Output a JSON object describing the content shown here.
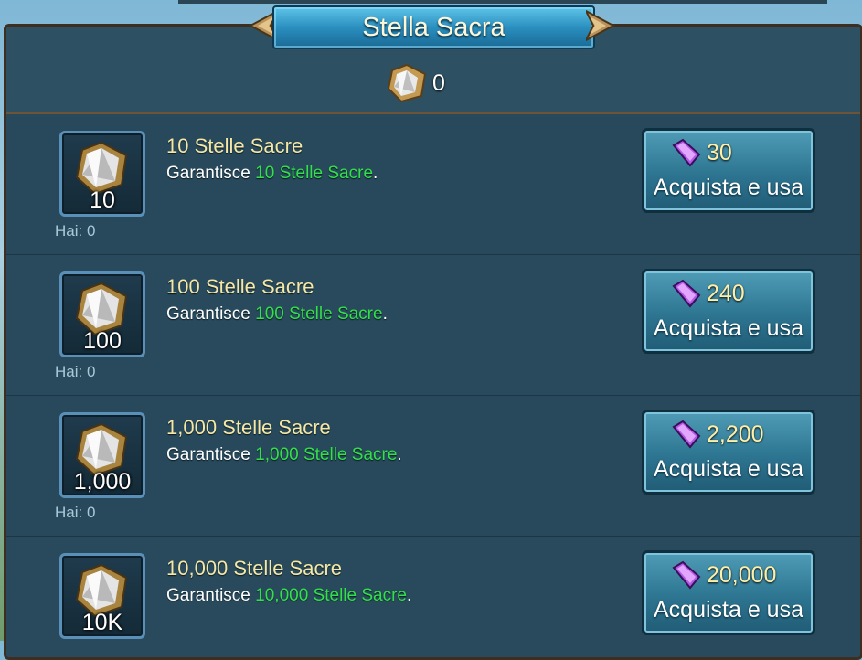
{
  "title": "Stella Sacra",
  "owned_total": "0",
  "items": [
    {
      "qty_badge": "10",
      "name": "10 Stelle Sacre",
      "desc_prefix": "Garantisce ",
      "desc_highlight": "10 Stelle Sacre",
      "desc_suffix": ".",
      "have": "Hai: 0",
      "price": "30",
      "button_label": "Acquista e usa"
    },
    {
      "qty_badge": "100",
      "name": "100 Stelle Sacre",
      "desc_prefix": "Garantisce ",
      "desc_highlight": "100 Stelle Sacre",
      "desc_suffix": ".",
      "have": "Hai: 0",
      "price": "240",
      "button_label": "Acquista e usa"
    },
    {
      "qty_badge": "1,000",
      "name": "1,000 Stelle Sacre",
      "desc_prefix": "Garantisce ",
      "desc_highlight": "1,000 Stelle Sacre",
      "desc_suffix": ".",
      "have": "Hai: 0",
      "price": "2,200",
      "button_label": "Acquista e usa"
    },
    {
      "qty_badge": "10K",
      "name": "10,000 Stelle Sacre",
      "desc_prefix": "Garantisce ",
      "desc_highlight": "10,000 Stelle Sacre",
      "desc_suffix": ".",
      "have": "",
      "price": "20,000",
      "button_label": "Acquista e usa"
    }
  ],
  "icons": {
    "item": "holy-star-icon",
    "currency": "purple-gem-icon"
  },
  "colors": {
    "highlight": "#33e04a",
    "title_text": "#f5e7a6",
    "price_text": "#fff0a8",
    "panel": "#27495b"
  }
}
